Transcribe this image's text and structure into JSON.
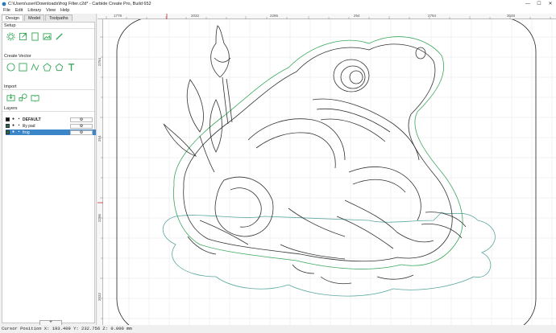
{
  "window": {
    "title": "C:\\Users\\user\\Downloads\\frog Filter.c2d* - Carbide Create Pro, Build 652",
    "minimize": "—",
    "maximize": "☐",
    "close": "✕"
  },
  "menu": {
    "items": [
      "File",
      "Edit",
      "Library",
      "View",
      "Help"
    ]
  },
  "tabs": [
    "Design",
    "Model",
    "Toolpaths"
  ],
  "setup": {
    "title": "Setup"
  },
  "create_vector": {
    "title": "Create Vector"
  },
  "import": {
    "title": "Import"
  },
  "layers": {
    "title": "Layers",
    "items": [
      {
        "name": "DEFAULT",
        "color": "#111111",
        "selected": false,
        "bold": true
      },
      {
        "name": "lily pad",
        "color": "#1f6e4e",
        "selected": false,
        "bold": false
      },
      {
        "name": "frog",
        "color": "#1f6e4e",
        "selected": true,
        "bold": false
      }
    ],
    "add_label": "+"
  },
  "ruler": {
    "top": [
      "1778",
      "2032",
      "2286",
      "254",
      "2794",
      "3048"
    ],
    "left": [
      "2794",
      "254",
      "2286",
      "2032"
    ]
  },
  "status": {
    "text": "Cursor Position X: 193.409 Y: 232.756 Z: 0.000 mm"
  },
  "colors": {
    "accent": "#3a86c8",
    "lily": "#5aa8a0",
    "outline": "#3aa85a",
    "frog": "#333333"
  }
}
